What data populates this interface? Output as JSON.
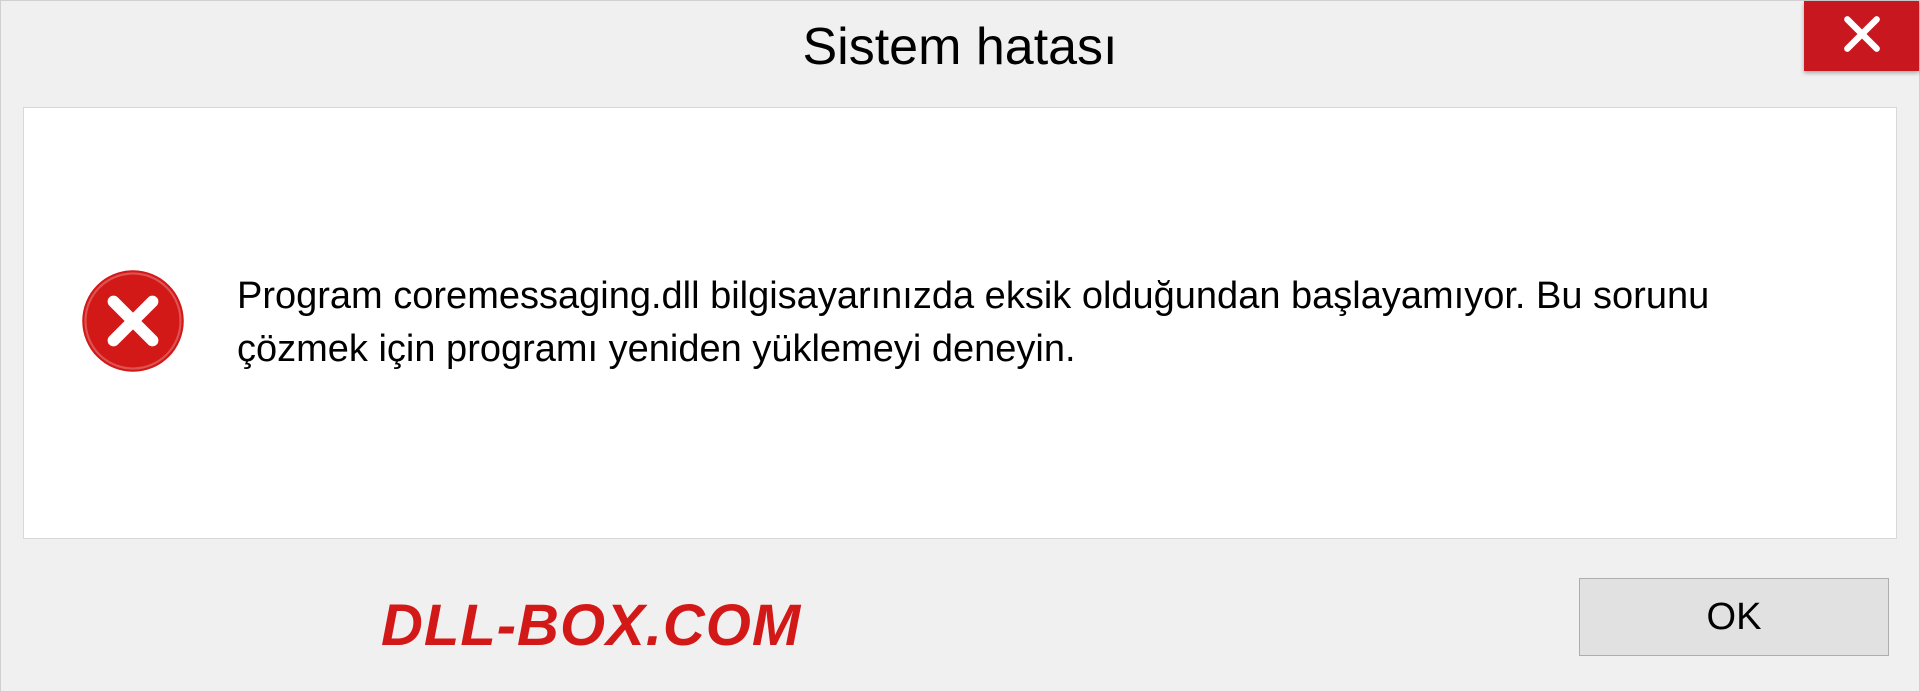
{
  "titlebar": {
    "title": "Sistem hatası"
  },
  "message": {
    "text": "Program coremessaging.dll bilgisayarınızda eksik olduğundan başlayamıyor. Bu sorunu çözmek için programı yeniden yüklemeyi deneyin."
  },
  "footer": {
    "watermark": "DLL-BOX.COM",
    "ok_label": "OK"
  },
  "colors": {
    "close_bg": "#c8171e",
    "error_icon": "#d31818",
    "watermark": "#d31818"
  }
}
